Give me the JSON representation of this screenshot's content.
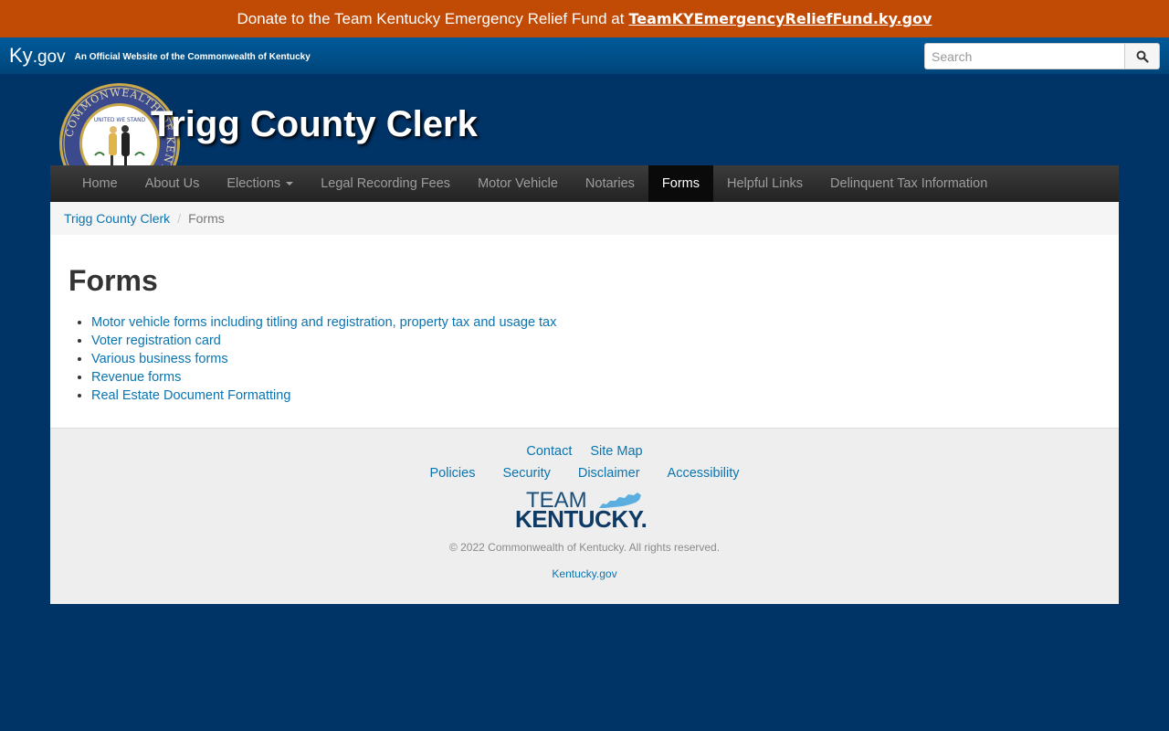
{
  "banner": {
    "text": "Donate to the Team Kentucky Emergency Relief Fund at",
    "link": "TeamKYEmergencyReliefFund.ky.gov"
  },
  "kybar": {
    "logo_main": "Ky",
    "logo_suffix": ".gov",
    "tagline": "An Official Website of the Commonwealth of Kentucky",
    "search_placeholder": "Search"
  },
  "header": {
    "title": "Trigg County Clerk",
    "seal_ring_text": "COMMONWEALTH OF KENTUCKY",
    "seal_motto": "UNITED WE STAND"
  },
  "nav": {
    "items": [
      {
        "label": "Home"
      },
      {
        "label": "About Us"
      },
      {
        "label": "Elections"
      },
      {
        "label": "Legal Recording Fees"
      },
      {
        "label": "Motor Vehicle"
      },
      {
        "label": "Notaries"
      },
      {
        "label": "Forms"
      },
      {
        "label": "Helpful Links"
      },
      {
        "label": "Delinquent Tax Information"
      }
    ],
    "active": "Forms"
  },
  "breadcrumb": {
    "home": "Trigg County Clerk",
    "current": "Forms"
  },
  "content": {
    "heading": "Forms",
    "links": [
      "Motor vehicle forms including titling and registration, property tax and usage tax",
      "Voter registration card",
      "Various business forms",
      "Revenue forms",
      "Real Estate Document Formatting"
    ]
  },
  "footer": {
    "row1": [
      "Contact",
      "Site Map"
    ],
    "row2": [
      "Policies",
      "Security",
      "Disclaimer",
      "Accessibility"
    ],
    "logo_team": "TEAM",
    "logo_kentucky": "KENTUCKY.",
    "copyright": "© 2022 Commonwealth of Kentucky. All rights reserved.",
    "kygov": "Kentucky.gov"
  },
  "colors": {
    "banner": "#c14a05",
    "page_bg": "#003366",
    "link": "#0a74b0",
    "navbar": "#222222"
  }
}
